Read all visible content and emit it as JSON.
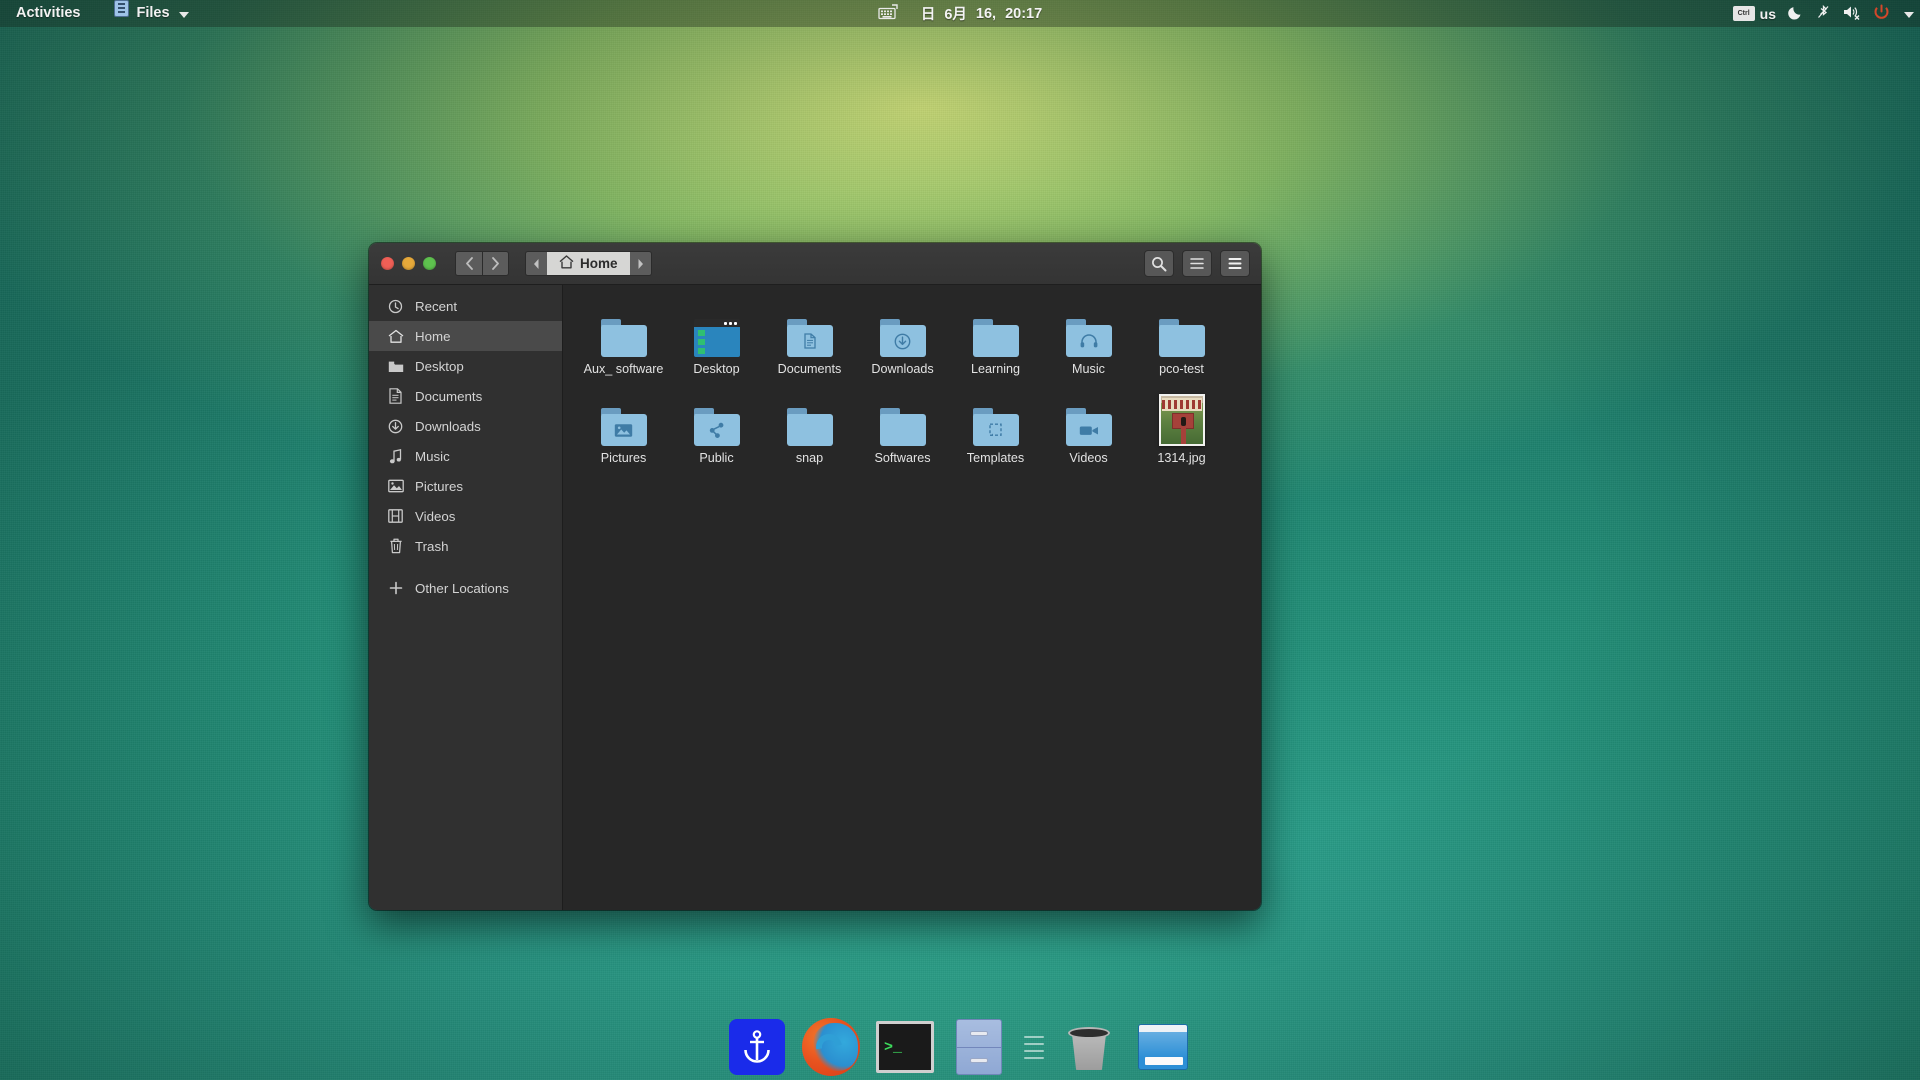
{
  "topbar": {
    "activities": "Activities",
    "app_name": "Files",
    "app_icon": "files-app-icon",
    "clock": {
      "weekday": "日",
      "month": "6月",
      "day": "16,",
      "time": "20:17"
    },
    "indicators": {
      "keyboard_badge": "Ctrl",
      "keyboard_layout": "us",
      "night_light_icon": "moon-icon",
      "bluetooth_icon": "bluetooth-off-icon",
      "volume_icon": "volume-muted-icon",
      "power_icon": "power-icon",
      "menu_icon": "chevron-down-icon"
    }
  },
  "window": {
    "title": "Home",
    "headerbar": {
      "close": "close",
      "minimize": "minimize",
      "maximize": "maximize",
      "back": "back",
      "forward": "forward",
      "path_prev": "path-scroll-left",
      "path_next": "path-scroll-right",
      "current_path": "Home",
      "search_label": "search",
      "view_label": "view-options",
      "menu_label": "main-menu"
    },
    "sidebar": [
      {
        "label": "Recent",
        "icon": "clock-history-icon",
        "selected": false
      },
      {
        "label": "Home",
        "icon": "home-icon",
        "selected": true
      },
      {
        "label": "Desktop",
        "icon": "folder-icon",
        "selected": false
      },
      {
        "label": "Documents",
        "icon": "document-icon",
        "selected": false
      },
      {
        "label": "Downloads",
        "icon": "download-icon",
        "selected": false
      },
      {
        "label": "Music",
        "icon": "music-note-icon",
        "selected": false
      },
      {
        "label": "Pictures",
        "icon": "image-icon",
        "selected": false
      },
      {
        "label": "Videos",
        "icon": "film-icon",
        "selected": false
      },
      {
        "label": "Trash",
        "icon": "trash-icon",
        "selected": false
      },
      {
        "label": "Other Locations",
        "icon": "plus-icon",
        "selected": false
      }
    ],
    "files": [
      {
        "label": "Aux_ software",
        "type": "folder",
        "emblem": "none"
      },
      {
        "label": "Desktop",
        "type": "desktop",
        "emblem": "desktop-window"
      },
      {
        "label": "Documents",
        "type": "folder",
        "emblem": "document"
      },
      {
        "label": "Downloads",
        "type": "folder",
        "emblem": "download"
      },
      {
        "label": "Learning",
        "type": "folder",
        "emblem": "none"
      },
      {
        "label": "Music",
        "type": "folder",
        "emblem": "headphones"
      },
      {
        "label": "pco-test",
        "type": "folder",
        "emblem": "none"
      },
      {
        "label": "Pictures",
        "type": "folder",
        "emblem": "image"
      },
      {
        "label": "Public",
        "type": "folder",
        "emblem": "share"
      },
      {
        "label": "snap",
        "type": "folder",
        "emblem": "none"
      },
      {
        "label": "Softwares",
        "type": "folder",
        "emblem": "none"
      },
      {
        "label": "Templates",
        "type": "folder",
        "emblem": "template"
      },
      {
        "label": "Videos",
        "type": "folder",
        "emblem": "camera"
      },
      {
        "label": "1314.jpg",
        "type": "image",
        "emblem": "photo-thumbnail"
      }
    ]
  },
  "dock": [
    {
      "name": "plank",
      "icon": "anchor-icon"
    },
    {
      "name": "firefox",
      "icon": "firefox-icon"
    },
    {
      "name": "terminal",
      "icon": "terminal-icon"
    },
    {
      "name": "files",
      "icon": "file-cabinet-icon"
    },
    {
      "name": "separator",
      "icon": "dock-separator-icon"
    },
    {
      "name": "trash",
      "icon": "trash-can-icon"
    },
    {
      "name": "display",
      "icon": "window-icon"
    }
  ],
  "colors": {
    "accent": "#2c8fd6",
    "folder": "#8ec1e0",
    "window_bg": "#272727",
    "sidebar_bg": "#303030",
    "headerbar_bg": "#3b3b3b",
    "selection": "#4a4a4a",
    "power": "#d4472a"
  }
}
